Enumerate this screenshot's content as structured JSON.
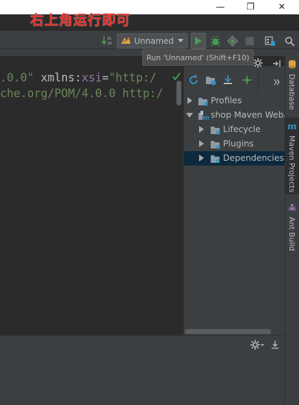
{
  "annotation": "右上角运行即可",
  "window_controls": {
    "minimize": "—",
    "restore": "❐",
    "close": "✕"
  },
  "run_config": {
    "name": "Unnamed"
  },
  "tooltip": {
    "text": "Run 'Unnamed' (Shift+F10)"
  },
  "editor": {
    "line1": {
      "version": ".0.0\"",
      "xmlns": " xmlns:",
      "ns": "xsi",
      "eq": "=",
      "url": "\"http:/"
    },
    "line2": {
      "text": "che.org/POM/4.0.0 http:/"
    }
  },
  "maven": {
    "tree": [
      {
        "label": "Profiles",
        "expanded": false
      },
      {
        "label": "shop Maven Weba",
        "expanded": true
      },
      {
        "label": "Lifecycle",
        "expanded": false
      },
      {
        "label": "Plugins",
        "expanded": false
      },
      {
        "label": "Dependencies",
        "expanded": false,
        "selected": true
      }
    ]
  },
  "side_tabs": {
    "database": "Database",
    "maven_projects": "Maven Projects",
    "ant_build": "Ant Build"
  },
  "colors": {
    "accent_green": "#499c54",
    "annotation_red": "#e0312a",
    "selection": "#0d293e",
    "maven_blue": "#3592c4"
  }
}
